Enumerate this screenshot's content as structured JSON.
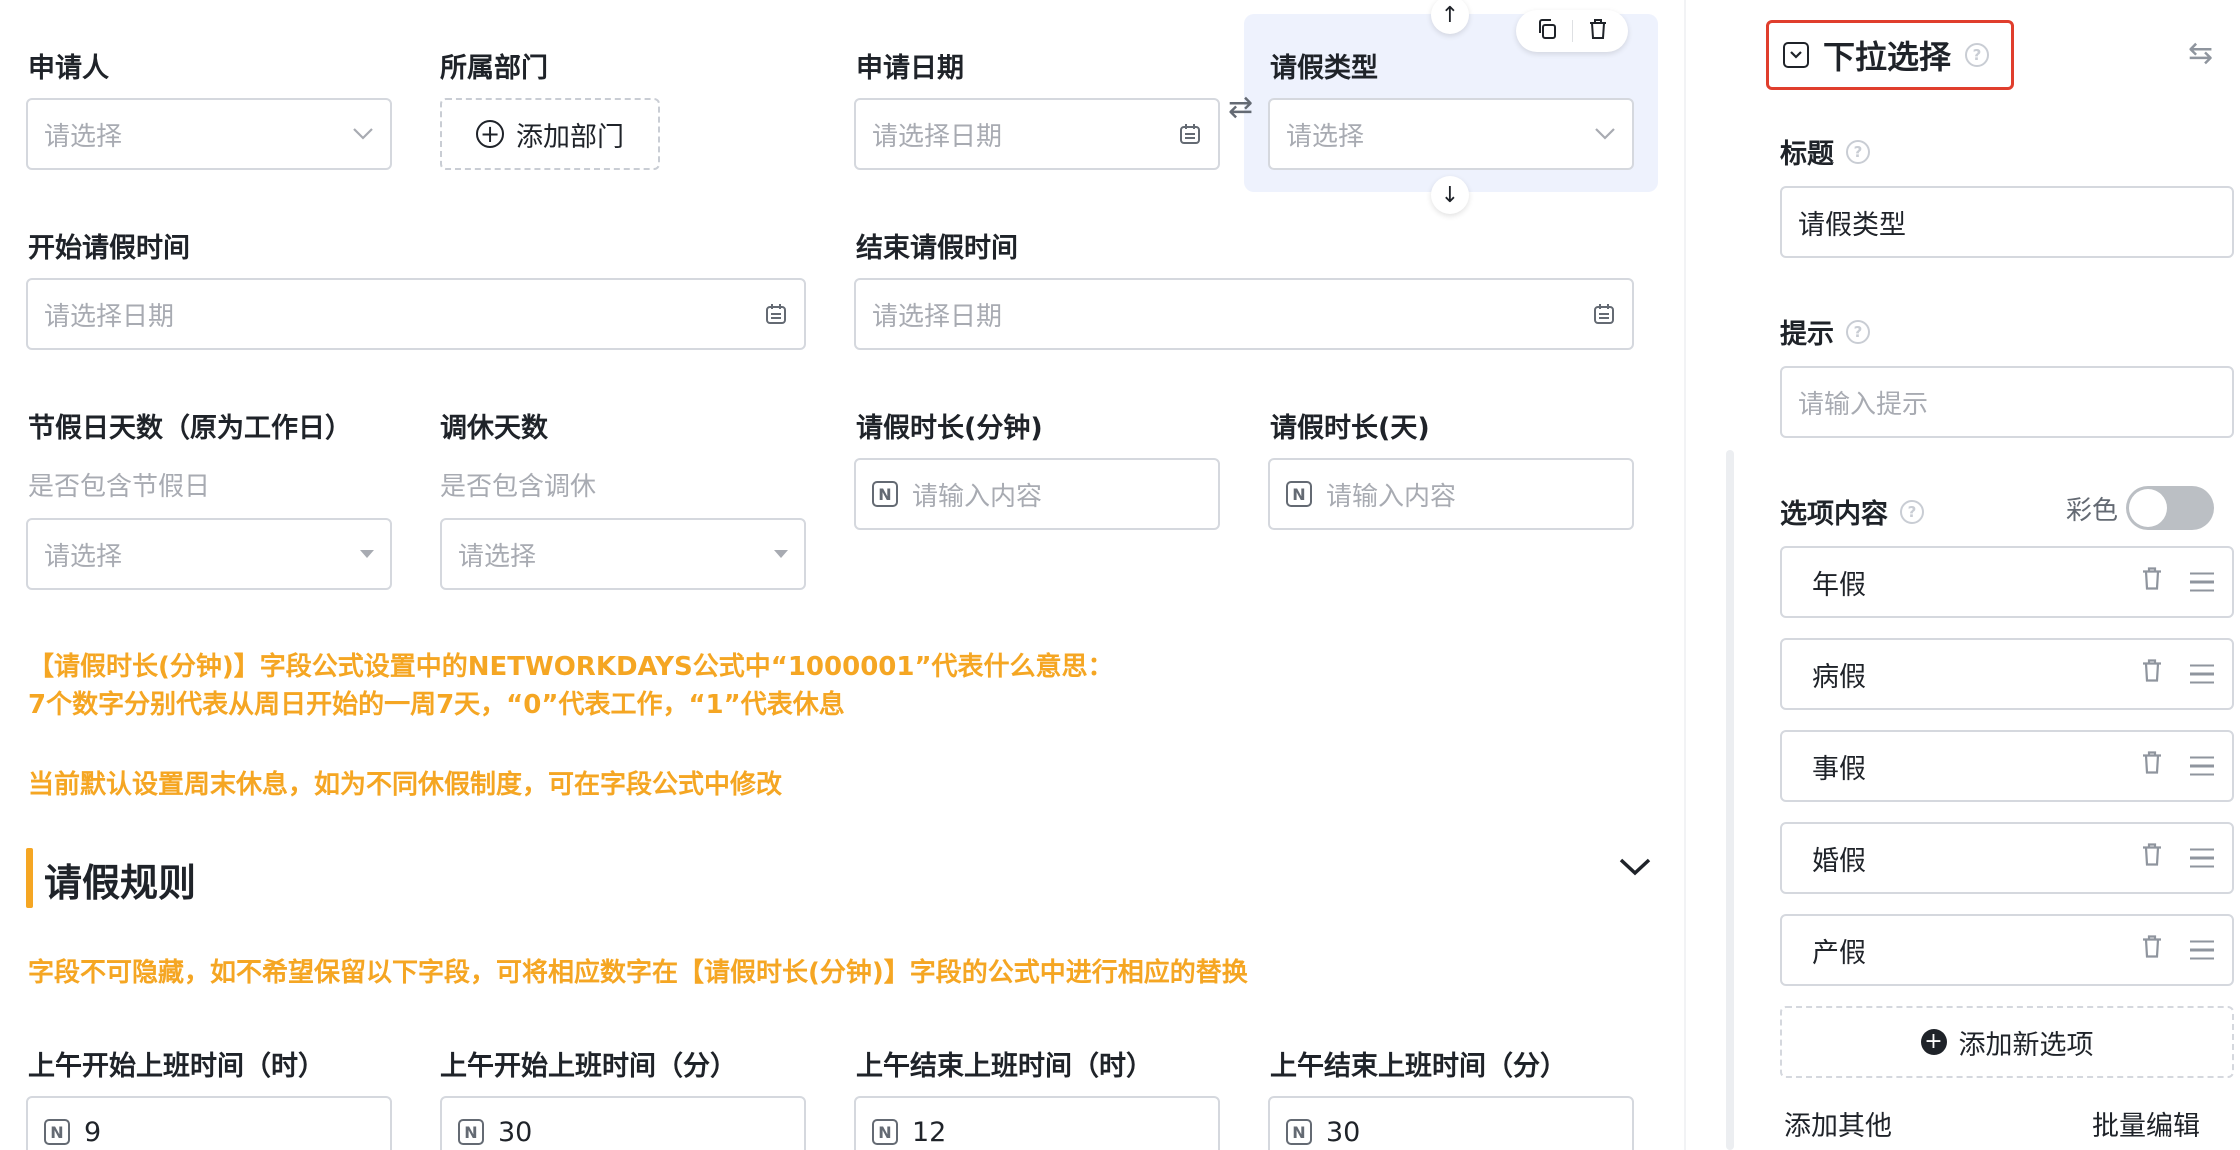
{
  "form": {
    "applicant": {
      "label": "申请人",
      "placeholder": "请选择"
    },
    "department": {
      "label": "所属部门",
      "button": "添加部门"
    },
    "apply_date": {
      "label": "申请日期",
      "placeholder": "请选择日期"
    },
    "leave_type": {
      "label": "请假类型",
      "placeholder": "请选择"
    },
    "leave_start": {
      "label": "开始请假时间",
      "placeholder": "请选择日期"
    },
    "leave_end": {
      "label": "结束请假时间",
      "placeholder": "请选择日期"
    },
    "holiday_days": {
      "label": "节假日天数（原为工作日）",
      "hint": "是否包含节假日",
      "placeholder": "请选择"
    },
    "rest_days": {
      "label": "调休天数",
      "hint": "是否包含调休",
      "placeholder": "请选择"
    },
    "duration_min": {
      "label": "请假时长(分钟)",
      "placeholder": "请输入内容"
    },
    "duration_day": {
      "label": "请假时长(天)",
      "placeholder": "请输入内容"
    },
    "notes": [
      "【请假时长(分钟)】字段公式设置中的NETWORKDAYS公式中“1000001”代表什么意思：",
      "7个数字分别代表从周日开始的一周7天，“0”代表工作，“1”代表休息",
      "当前默认设置周末休息，如为不同休假制度，可在字段公式中修改"
    ],
    "section": {
      "title": "请假规则",
      "note": "字段不可隐藏，如不希望保留以下字段，可将相应数字在【请假时长(分钟)】字段的公式中进行相应的替换"
    },
    "am_fields": [
      {
        "label": "上午开始上班时间（时）",
        "value": "9"
      },
      {
        "label": "上午开始上班时间（分）",
        "value": "30"
      },
      {
        "label": "上午结束上班时间（时）",
        "value": "12"
      },
      {
        "label": "上午结束上班时间（分）",
        "value": "30"
      }
    ],
    "number_icon": "N"
  },
  "panel": {
    "header": "下拉选择",
    "title_label": "标题",
    "title_value": "请假类型",
    "hint_label": "提示",
    "hint_placeholder": "请输入提示",
    "options_label": "选项内容",
    "colorful_label": "彩色",
    "colorful_on": false,
    "options": [
      "年假",
      "病假",
      "事假",
      "婚假",
      "产假"
    ],
    "add_option": "添加新选项",
    "add_other": "添加其他",
    "batch_edit": "批量编辑"
  },
  "colors": {
    "accent_orange": "#f5a623",
    "highlight_red": "#e03e2d",
    "selected_bg": "#eef2fd"
  }
}
